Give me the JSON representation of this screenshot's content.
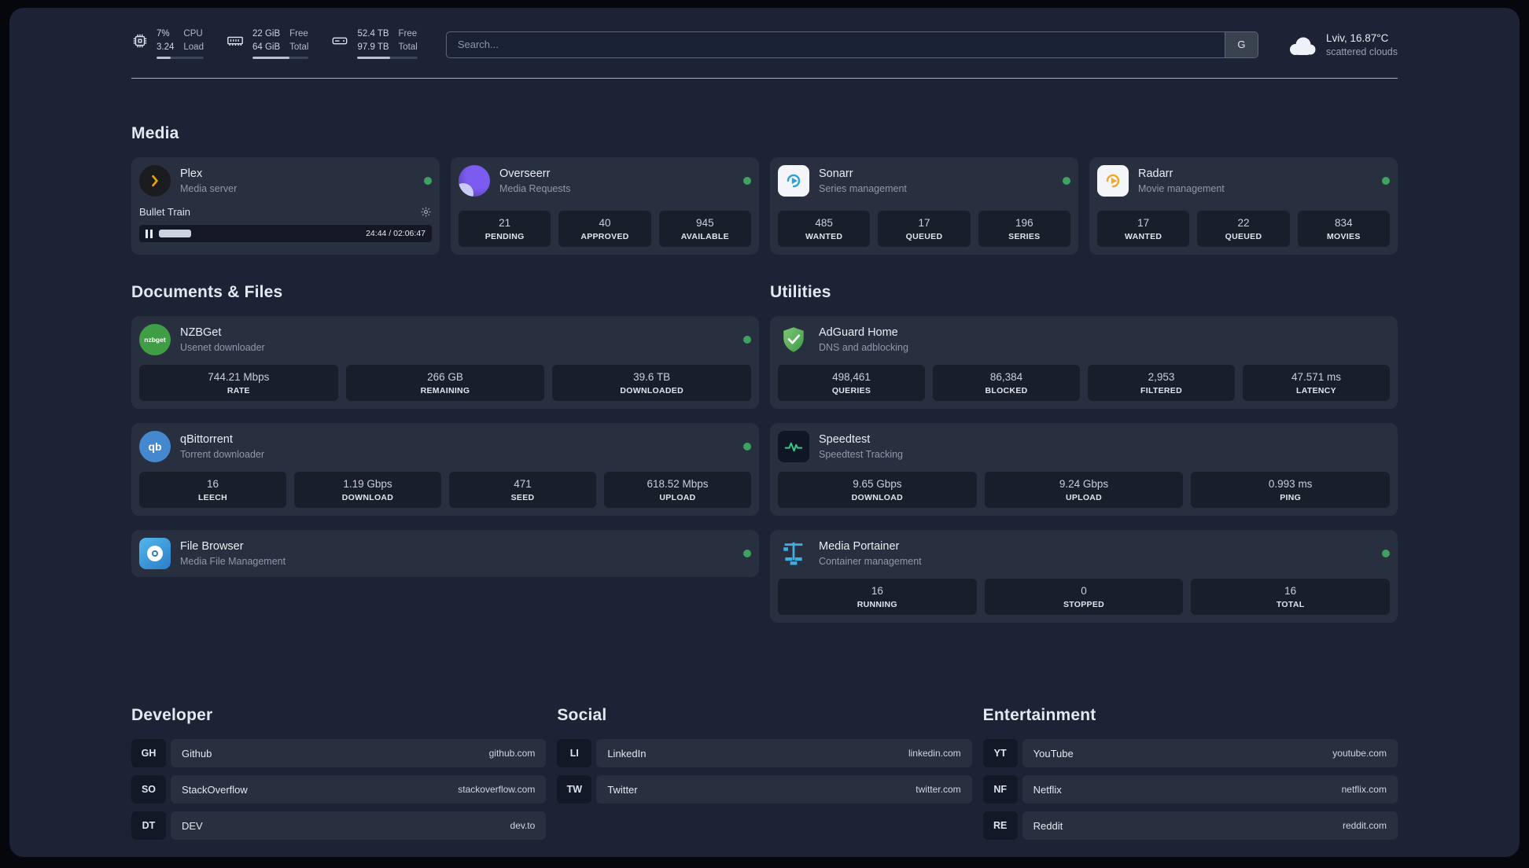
{
  "topbar": {
    "cpu": {
      "percent": "7%",
      "load": "3.24",
      "label_top": "CPU",
      "label_bottom": "Load",
      "bar_width": "30%"
    },
    "ram": {
      "free": "22 GiB",
      "total": "64 GiB",
      "label_top": "Free",
      "label_bottom": "Total",
      "bar_width": "66%"
    },
    "disk": {
      "free": "52.4 TB",
      "total": "97.9 TB",
      "label_top": "Free",
      "label_bottom": "Total",
      "bar_width": "54%"
    },
    "search": {
      "placeholder": "Search...",
      "button": "G"
    },
    "weather": {
      "location": "Lviv, 16.87°C",
      "condition": "scattered clouds"
    }
  },
  "sections": {
    "media": "Media",
    "documents": "Documents & Files",
    "utilities": "Utilities",
    "developer": "Developer",
    "social": "Social",
    "entertainment": "Entertainment"
  },
  "media": {
    "plex": {
      "name": "Plex",
      "subtitle": "Media server",
      "now_playing": "Bullet Train",
      "time": "24:44 / 02:06:47",
      "progress": "16%"
    },
    "overseerr": {
      "name": "Overseerr",
      "subtitle": "Media Requests",
      "stats": [
        {
          "value": "21",
          "label": "PENDING"
        },
        {
          "value": "40",
          "label": "APPROVED"
        },
        {
          "value": "945",
          "label": "AVAILABLE"
        }
      ]
    },
    "sonarr": {
      "name": "Sonarr",
      "subtitle": "Series management",
      "stats": [
        {
          "value": "485",
          "label": "WANTED"
        },
        {
          "value": "17",
          "label": "QUEUED"
        },
        {
          "value": "196",
          "label": "SERIES"
        }
      ]
    },
    "radarr": {
      "name": "Radarr",
      "subtitle": "Movie management",
      "stats": [
        {
          "value": "17",
          "label": "WANTED"
        },
        {
          "value": "22",
          "label": "QUEUED"
        },
        {
          "value": "834",
          "label": "MOVIES"
        }
      ]
    }
  },
  "documents": {
    "nzbget": {
      "name": "NZBGet",
      "subtitle": "Usenet downloader",
      "icon_text": "nzbget",
      "stats": [
        {
          "value": "744.21 Mbps",
          "label": "RATE"
        },
        {
          "value": "266 GB",
          "label": "REMAINING"
        },
        {
          "value": "39.6 TB",
          "label": "DOWNLOADED"
        }
      ]
    },
    "qbittorrent": {
      "name": "qBittorrent",
      "subtitle": "Torrent downloader",
      "icon_text": "qb",
      "stats": [
        {
          "value": "16",
          "label": "LEECH"
        },
        {
          "value": "1.19 Gbps",
          "label": "DOWNLOAD"
        },
        {
          "value": "471",
          "label": "SEED"
        },
        {
          "value": "618.52 Mbps",
          "label": "UPLOAD"
        }
      ]
    },
    "filebrowser": {
      "name": "File Browser",
      "subtitle": "Media File Management"
    }
  },
  "utilities": {
    "adguard": {
      "name": "AdGuard Home",
      "subtitle": "DNS and adblocking",
      "stats": [
        {
          "value": "498,461",
          "label": "QUERIES"
        },
        {
          "value": "86,384",
          "label": "BLOCKED"
        },
        {
          "value": "2,953",
          "label": "FILTERED"
        },
        {
          "value": "47.571 ms",
          "label": "LATENCY"
        }
      ]
    },
    "speedtest": {
      "name": "Speedtest",
      "subtitle": "Speedtest Tracking",
      "stats": [
        {
          "value": "9.65 Gbps",
          "label": "DOWNLOAD"
        },
        {
          "value": "9.24 Gbps",
          "label": "UPLOAD"
        },
        {
          "value": "0.993 ms",
          "label": "PING"
        }
      ]
    },
    "portainer": {
      "name": "Media Portainer",
      "subtitle": "Container management",
      "stats": [
        {
          "value": "16",
          "label": "RUNNING"
        },
        {
          "value": "0",
          "label": "STOPPED"
        },
        {
          "value": "16",
          "label": "TOTAL"
        }
      ]
    }
  },
  "links": {
    "developer": [
      {
        "abbr": "GH",
        "name": "Github",
        "url": "github.com"
      },
      {
        "abbr": "SO",
        "name": "StackOverflow",
        "url": "stackoverflow.com"
      },
      {
        "abbr": "DT",
        "name": "DEV",
        "url": "dev.to"
      }
    ],
    "social": [
      {
        "abbr": "LI",
        "name": "LinkedIn",
        "url": "linkedin.com"
      },
      {
        "abbr": "TW",
        "name": "Twitter",
        "url": "twitter.com"
      }
    ],
    "entertainment": [
      {
        "abbr": "YT",
        "name": "YouTube",
        "url": "youtube.com"
      },
      {
        "abbr": "NF",
        "name": "Netflix",
        "url": "netflix.com"
      },
      {
        "abbr": "RE",
        "name": "Reddit",
        "url": "reddit.com"
      }
    ]
  },
  "colors": {
    "status_green": "#3da35f",
    "plex_amber": "#e5a00d"
  }
}
